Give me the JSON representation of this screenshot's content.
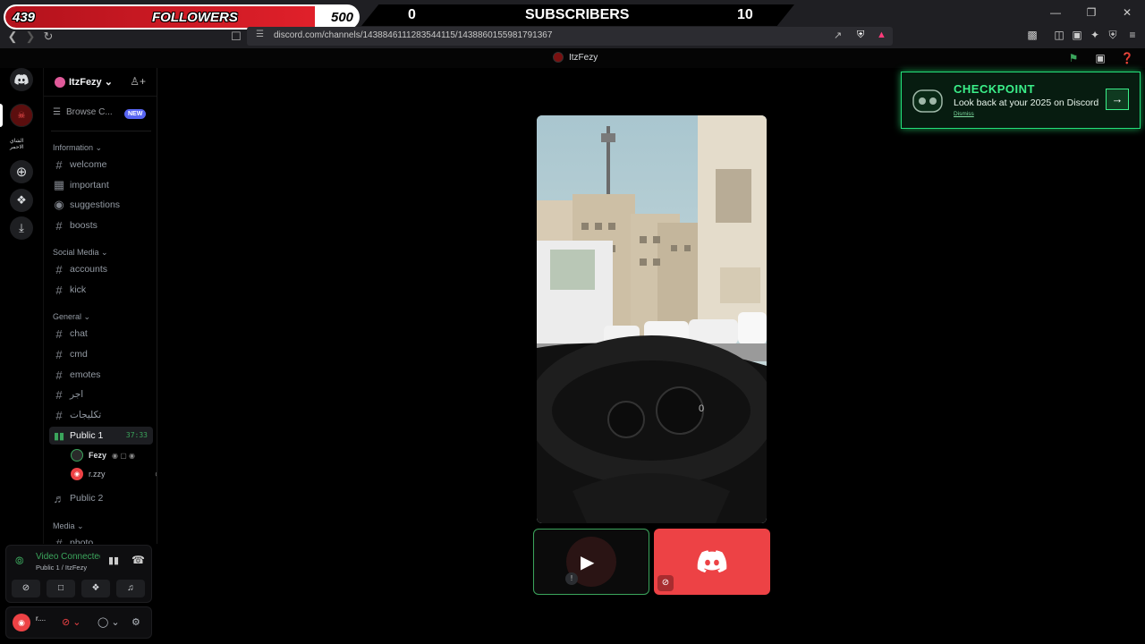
{
  "overlay": {
    "followers_current": "439",
    "followers_label": "FOLLOWERS",
    "followers_goal": "500",
    "followers_progress": 0.878,
    "subscribers_current": "0",
    "subscribers_label": "SUBSCRIBERS",
    "subscribers_goal": "10"
  },
  "browser": {
    "url": "discord.com/channels/1438846111283544115/1438860155981791367"
  },
  "titlebar": {
    "server_name": "ItzFezy"
  },
  "server": {
    "name": "ItzFezy",
    "browse_label": "Browse C...",
    "new_badge": "NEW"
  },
  "rail": {
    "server2_label": "الشاي الاحمر"
  },
  "categories": {
    "information": "Information",
    "social": "Social Media",
    "general": "General",
    "media": "Media"
  },
  "channels": {
    "welcome": "welcome",
    "important": "important",
    "suggestions": "suggestions",
    "boosts": "boosts",
    "accounts": "accounts",
    "kick": "kick",
    "chat": "chat",
    "cmd": "cmd",
    "emotes": "emotes",
    "arabic1": "اجر",
    "arabic2": "تكليجات",
    "public1": "Public 1",
    "public1_timer": "37:33",
    "public2": "Public 2",
    "photo": "photo"
  },
  "voice_users": [
    {
      "name": "Fezy"
    },
    {
      "name": "r.zzy"
    }
  ],
  "voice_panel": {
    "status": "Video Connected",
    "location": "Public 1 / ItzFezy"
  },
  "user_panel": {
    "name": "r...."
  },
  "checkpoint": {
    "title": "CHECKPOINT",
    "subtitle": "Look back at your 2025 on Discord",
    "dismiss": "Dismiss"
  },
  "stage": {
    "dashboard_value": "0"
  },
  "colors": {
    "accent_green": "#3ba55c",
    "discord_red": "#ed4245",
    "blurple": "#5865f2",
    "checkpoint_green": "#3bf08a"
  }
}
